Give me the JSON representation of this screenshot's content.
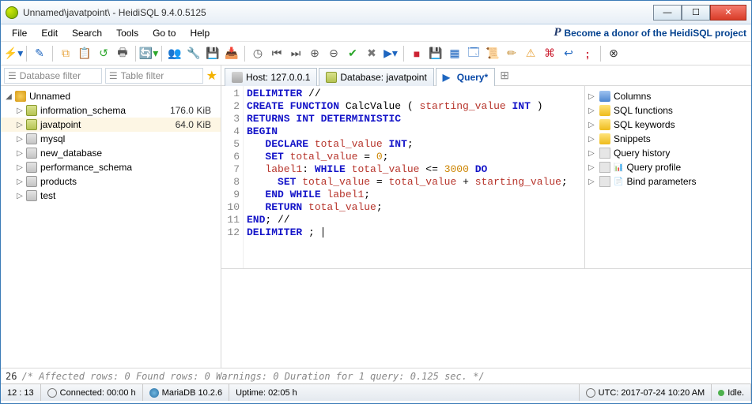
{
  "window": {
    "title": "Unnamed\\javatpoint\\ - HeidiSQL 9.4.0.5125"
  },
  "menu": [
    "File",
    "Edit",
    "Search",
    "Tools",
    "Go to",
    "Help"
  ],
  "donor_text": "Become a donor of the HeidiSQL project",
  "filters": {
    "db": "Database filter",
    "table": "Table filter"
  },
  "main_tabs": {
    "host": "Host: 127.0.0.1",
    "database": "Database: javatpoint",
    "query": "Query*"
  },
  "tree": {
    "root": "Unnamed",
    "items": [
      {
        "name": "information_schema",
        "size": "176.0 KiB",
        "sel": false,
        "icon": "cyl"
      },
      {
        "name": "javatpoint",
        "size": "64.0 KiB",
        "sel": true,
        "icon": "cyl"
      },
      {
        "name": "mysql",
        "size": "",
        "sel": false,
        "icon": "cylg"
      },
      {
        "name": "new_database",
        "size": "",
        "sel": false,
        "icon": "cylg"
      },
      {
        "name": "performance_schema",
        "size": "",
        "sel": false,
        "icon": "cylg"
      },
      {
        "name": "products",
        "size": "",
        "sel": false,
        "icon": "cylg"
      },
      {
        "name": "test",
        "size": "",
        "sel": false,
        "icon": "cylg"
      }
    ]
  },
  "code_lines": [
    [
      [
        "kw",
        "DELIMITER"
      ],
      [
        "fn",
        " //"
      ]
    ],
    [
      [
        "kw",
        "CREATE FUNCTION"
      ],
      [
        "fn",
        " CalcValue ( "
      ],
      [
        "ident",
        "starting_value"
      ],
      [
        "fn",
        " "
      ],
      [
        "kw",
        "INT"
      ],
      [
        "fn",
        " )"
      ]
    ],
    [
      [
        "kw",
        "RETURNS "
      ],
      [
        "kw",
        "INT"
      ],
      [
        "fn",
        " "
      ],
      [
        "kw",
        "DETERMINISTIC"
      ]
    ],
    [
      [
        "kw",
        "BEGIN"
      ]
    ],
    [
      [
        "fn",
        "   "
      ],
      [
        "kw",
        "DECLARE"
      ],
      [
        "fn",
        " "
      ],
      [
        "ident",
        "total_value"
      ],
      [
        "fn",
        " "
      ],
      [
        "kw",
        "INT"
      ],
      [
        "fn",
        ";"
      ]
    ],
    [
      [
        "fn",
        "   "
      ],
      [
        "kw",
        "SET"
      ],
      [
        "fn",
        " "
      ],
      [
        "ident",
        "total_value"
      ],
      [
        "fn",
        " = "
      ],
      [
        "num",
        "0"
      ],
      [
        "fn",
        ";"
      ]
    ],
    [
      [
        "fn",
        "   "
      ],
      [
        "ident",
        "label1"
      ],
      [
        "fn",
        ": "
      ],
      [
        "kw",
        "WHILE"
      ],
      [
        "fn",
        " "
      ],
      [
        "ident",
        "total_value"
      ],
      [
        "fn",
        " <= "
      ],
      [
        "num",
        "3000"
      ],
      [
        "fn",
        " "
      ],
      [
        "kw",
        "DO"
      ]
    ],
    [
      [
        "fn",
        "     "
      ],
      [
        "kw",
        "SET"
      ],
      [
        "fn",
        " "
      ],
      [
        "ident",
        "total_value"
      ],
      [
        "fn",
        " = "
      ],
      [
        "ident",
        "total_value"
      ],
      [
        "fn",
        " + "
      ],
      [
        "ident",
        "starting_value"
      ],
      [
        "fn",
        ";"
      ]
    ],
    [
      [
        "fn",
        "   "
      ],
      [
        "kw",
        "END WHILE"
      ],
      [
        "fn",
        " "
      ],
      [
        "ident",
        "label1"
      ],
      [
        "fn",
        ";"
      ]
    ],
    [
      [
        "fn",
        "   "
      ],
      [
        "kw",
        "RETURN"
      ],
      [
        "fn",
        " "
      ],
      [
        "ident",
        "total_value"
      ],
      [
        "fn",
        ";"
      ]
    ],
    [
      [
        "kw",
        "END"
      ],
      [
        "fn",
        "; //"
      ]
    ],
    [
      [
        "kw",
        "DELIMITER"
      ],
      [
        "fn",
        " ; "
      ]
    ]
  ],
  "helpers": [
    {
      "label": "Columns",
      "icon": "blu"
    },
    {
      "label": "SQL functions",
      "icon": "yel"
    },
    {
      "label": "SQL keywords",
      "icon": "yel"
    },
    {
      "label": "Snippets",
      "icon": "yel"
    },
    {
      "label": "Query history",
      "icon": "gry"
    },
    {
      "label": "Query profile",
      "icon": "gry"
    },
    {
      "label": "Bind parameters",
      "icon": "gry"
    }
  ],
  "status_query": {
    "line": "26",
    "msg": "/* Affected rows: 0  Found rows: 0  Warnings: 0  Duration for 1 query: 0.125 sec. */"
  },
  "statusbar": {
    "pos": "12 : 13",
    "connected": "Connected: 00:00 h",
    "server": "MariaDB 10.2.6",
    "uptime": "Uptime: 02:05 h",
    "utc": "UTC: 2017-07-24 10:20 AM",
    "idle": "Idle."
  }
}
